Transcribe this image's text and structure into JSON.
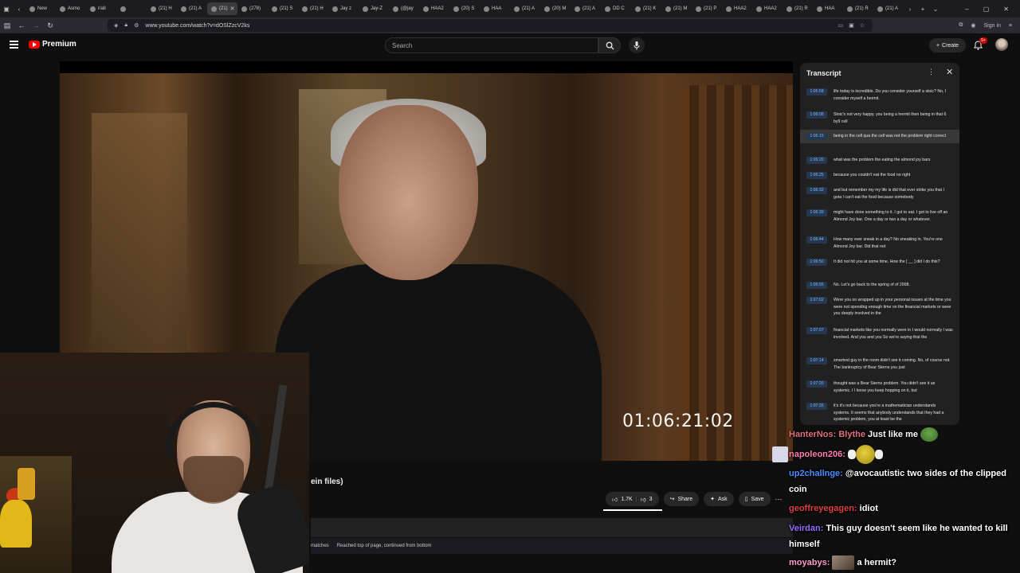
{
  "browser": {
    "tabs": [
      {
        "label": "New"
      },
      {
        "label": "Asmo"
      },
      {
        "label": "r/all"
      },
      {
        "label": ""
      },
      {
        "label": "(21) H"
      },
      {
        "label": "(21) A"
      },
      {
        "label": "(21)",
        "active": true
      },
      {
        "label": "(278)"
      },
      {
        "label": "(21) S"
      },
      {
        "label": "(21) H"
      },
      {
        "label": "Jay z"
      },
      {
        "label": "Jay-Z"
      },
      {
        "label": "(@jay"
      },
      {
        "label": "HAA2"
      },
      {
        "label": "(20) S"
      },
      {
        "label": "HAA"
      },
      {
        "label": "(21) A"
      },
      {
        "label": "(20) M"
      },
      {
        "label": "(21) A"
      },
      {
        "label": "DD C"
      },
      {
        "label": "(21) K"
      },
      {
        "label": "(21) M"
      },
      {
        "label": "(21) P"
      },
      {
        "label": "HAA2"
      },
      {
        "label": "HAA2"
      },
      {
        "label": "(21) R"
      },
      {
        "label": "HAA"
      },
      {
        "label": "(21) R"
      },
      {
        "label": "(21) A"
      }
    ],
    "url": "www.youtube.com/watch?v=dOSlZzcV2ks",
    "sign_in": "Sign in"
  },
  "youtube": {
    "logo_text": "Premium",
    "search_placeholder": "Search",
    "create_label": "Create",
    "notif_count": "9+"
  },
  "video": {
    "timecode": "01:06:21:02",
    "title_fragment": "ein files)",
    "likes": "1.7K",
    "dislikes": "3",
    "share_label": "Share",
    "ask_label": "Ask",
    "save_label": "Save"
  },
  "findbar": {
    "matches": "matches",
    "status": "Reached top of page, continued from bottom"
  },
  "transcript": {
    "title": "Transcript",
    "segments": [
      {
        "t": "1:05:58",
        "text": "life today is incredible. Do you consider yourself a stoic? No, I consider myself a hermit."
      },
      {
        "t": "1:06:08",
        "text": "Stoic's not very happy. you being a hermit then being in that 6 by9 cell"
      },
      {
        "t": "1:06:15",
        "text": "being in the cell qua the cell was not the problem right correct",
        "active": true
      },
      {
        "t": "1:06:20",
        "text": "what was the problem the eating the almond joy bars"
      },
      {
        "t": "1:06:25",
        "text": "because you couldn't eat the food no right"
      },
      {
        "t": "1:06:32",
        "text": "and but remember my my life is did that ever strike you that I gota I can't eat the food because somebody"
      },
      {
        "t": "1:06:39",
        "text": "might have done something to it. I got to eat. I got to live off an Almond Joy bar. One a day or two a day or whatever."
      },
      {
        "t": "1:06:44",
        "text": "How many ever sneak in a day? No sneaking in. You're one Almond Joy bar. Did that not"
      },
      {
        "t": "1:06:50",
        "text": "It did not hit you at some time. How the [ __ ] did I do this?"
      },
      {
        "t": "1:06:55",
        "text": "No. Let's go back to the spring of of 2008."
      },
      {
        "t": "1:07:02",
        "text": "Were you so wrapped up in your personal issues at the time you were not spending enough time on the financial markets or were you deeply involved in the"
      },
      {
        "t": "1:07:07",
        "text": "financial markets like you normally were in I would normally I was involved. And you and you So we're saying that the"
      },
      {
        "t": "1:07:14",
        "text": "smartest guy in the room didn't see it coming. No, of course not. The bankruptcy of Bear Sterns you just"
      },
      {
        "t": "1:07:20",
        "text": "thought was a Bear Sterns problem. You didn't see it as systemic. I I know you keep hopping on it, but"
      },
      {
        "t": "1:07:26",
        "text": "it's it's not because you're a mathematician understands systems. It seems that anybody understands that they had a systemic problem, you at least be the"
      }
    ]
  },
  "chat": {
    "messages": [
      {
        "user": "HanterNos: Blythe",
        "color": "#e0707a",
        "text": "Just like me",
        "emote": "pepe"
      },
      {
        "user": "napoleon206:",
        "color": "#ff7fb0",
        "text": "",
        "emote": "ball"
      },
      {
        "user": "up2challnge:",
        "color": "#4a8cff",
        "text": "@avocautistic two sides of the clipped coin"
      },
      {
        "user": "geoffreyegagen:",
        "color": "#e04040",
        "text": "idiot"
      },
      {
        "user": "Veirdan:",
        "color": "#9a6aff",
        "text": "This guy doesn't seem like he wanted to kill himself"
      },
      {
        "user": "moyabys:",
        "color": "#ff9ad0",
        "text": "a hermit?",
        "emote": "photo"
      }
    ]
  }
}
